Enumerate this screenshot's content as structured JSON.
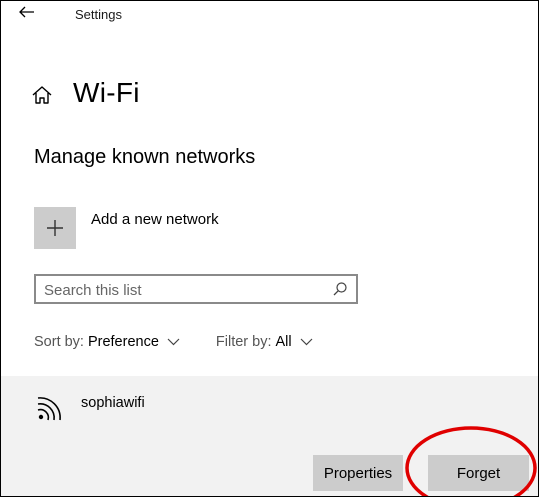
{
  "window": {
    "title": "Settings",
    "back_icon": "arrow-left-icon"
  },
  "header": {
    "home_icon": "home-icon",
    "title": "Wi-Fi"
  },
  "section": {
    "title": "Manage known networks"
  },
  "add_network": {
    "icon": "plus-icon",
    "label": "Add a new network"
  },
  "search": {
    "placeholder": "Search this list",
    "value": "",
    "icon": "search-icon"
  },
  "sort": {
    "label": "Sort by:",
    "value": "Preference"
  },
  "filter": {
    "label": "Filter by:",
    "value": "All"
  },
  "networks": [
    {
      "name": "sophiawifi",
      "icon": "wifi-signal-icon",
      "buttons": {
        "properties": "Properties",
        "forget": "Forget"
      }
    }
  ],
  "annotation": {
    "color": "#e00000",
    "target": "forget-button"
  },
  "colors": {
    "button_bg": "#cccccc",
    "card_bg": "#f2f2f2",
    "add_tile_bg": "#cccccc"
  }
}
